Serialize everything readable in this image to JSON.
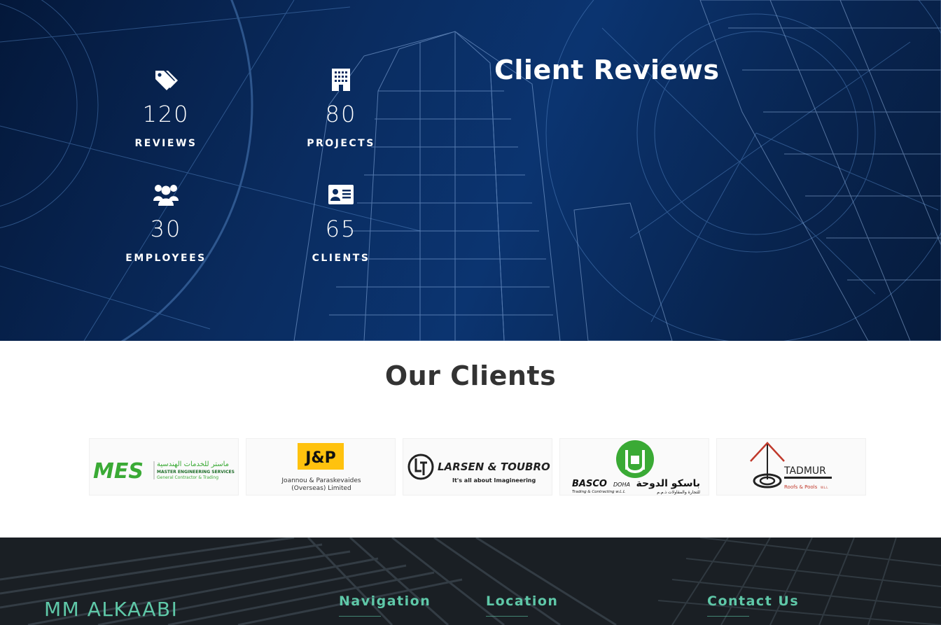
{
  "stats": [
    {
      "icon": "tags-icon",
      "value": "120",
      "label": "REVIEWS"
    },
    {
      "icon": "building-icon",
      "value": "80",
      "label": "PROJECTS"
    },
    {
      "icon": "users-icon",
      "value": "30",
      "label": "EMPLOYEES"
    },
    {
      "icon": "id-card-icon",
      "value": "65",
      "label": "CLIENTS"
    }
  ],
  "reviews_title": "Client Reviews",
  "clients": {
    "title": "Our Clients",
    "logos": [
      {
        "name": "MES",
        "arabic": "ماستر للخدمات الهندسية",
        "line1": "MASTER ENGINEERING SERVICES",
        "line2": "General Contractor & Trading"
      },
      {
        "name": "J&P",
        "line1": "Joannou & Paraskevaides",
        "line2": "(Overseas) Limited"
      },
      {
        "name": "LARSEN & TOUBRO",
        "line1": "It's all about Imagineering"
      },
      {
        "name": "BASCO",
        "suffix": "DOHA",
        "arabic": "باسكو الدوحة",
        "line1": "Trading & Contracting w.L.L",
        "line2": "للتجارة والمقاولات ذ.م.م"
      },
      {
        "name": "TADMUR",
        "line1": "Roofs & Pools",
        "line2": "W.L.L"
      }
    ]
  },
  "footer": {
    "brand": "MM ALKAABI",
    "headings": [
      "Navigation",
      "Location",
      "Contact Us"
    ]
  },
  "colors": {
    "hero_bg": "#0a2c60",
    "accent": "#5fc8a8",
    "heading_dark": "#333333",
    "mes_green": "#3aaa35",
    "jp_yellow": "#ffc20e",
    "tadmur_red": "#c0392b"
  }
}
